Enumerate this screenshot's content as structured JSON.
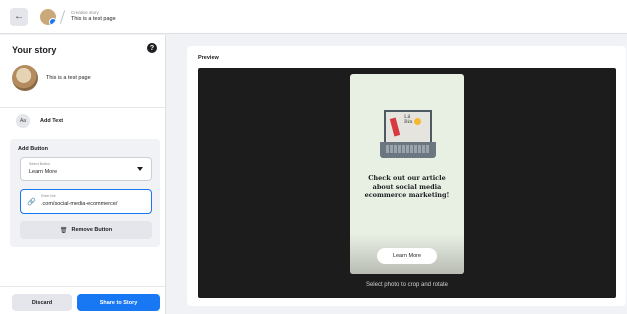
{
  "topbar": {
    "back_label": "←",
    "breadcrumb_sub": "Creative story",
    "breadcrumb_title": "This is a test page"
  },
  "left_panel": {
    "title": "Your story",
    "help_label": "?",
    "page_name": "This is a test page",
    "add_text_icon": "Aa",
    "add_text_label": "Add Text",
    "add_button_section": {
      "title": "Add Button",
      "select_sub_label": "Select Button",
      "select_value": "Learn More",
      "link_sub_label": "Enter link",
      "link_value": ".com/social-media-ecommerce/",
      "remove_label": "Remove Button"
    },
    "discard_label": "Discard",
    "share_label": "Share to Story"
  },
  "preview": {
    "label": "Preview",
    "note_line1": "Lil",
    "note_line2": "Bin",
    "headline": "Check out our article about social media ecommerce marketing!",
    "cta_label": "Learn More",
    "hint": "Select photo to crop and rotate"
  },
  "colors": {
    "accent": "#1877f2",
    "preview_bg": "#1c1c1c",
    "card_bg": "#e8efe3"
  },
  "icons": {
    "back": "arrow-left-icon",
    "help": "help-icon",
    "add_text": "text-aa-icon",
    "dropdown": "caret-down-icon",
    "link": "link-icon",
    "remove": "trash-icon"
  }
}
